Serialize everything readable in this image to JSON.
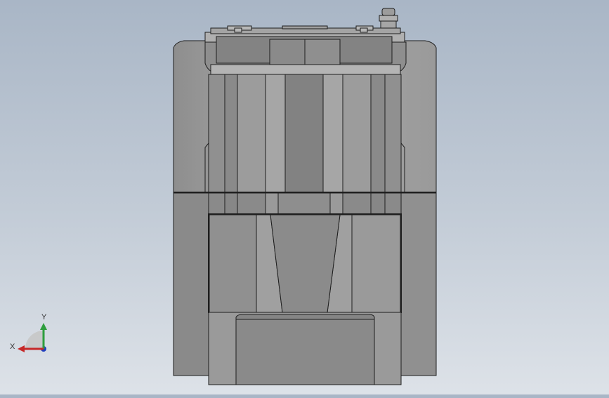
{
  "viewport": {
    "background_top": "#a9b6c6",
    "background_bottom": "#dde2e8",
    "model": {
      "outline_color": "#1e1e1e",
      "light_gray": "#a2a2a2",
      "mid_gray": "#8f8f8f",
      "dark_gray": "#7f7f7f"
    }
  },
  "triad": {
    "x_label": "X",
    "y_label": "Y",
    "x_color": "#c62828",
    "y_color": "#2e9e3e",
    "z_color": "#1e3fbf"
  }
}
